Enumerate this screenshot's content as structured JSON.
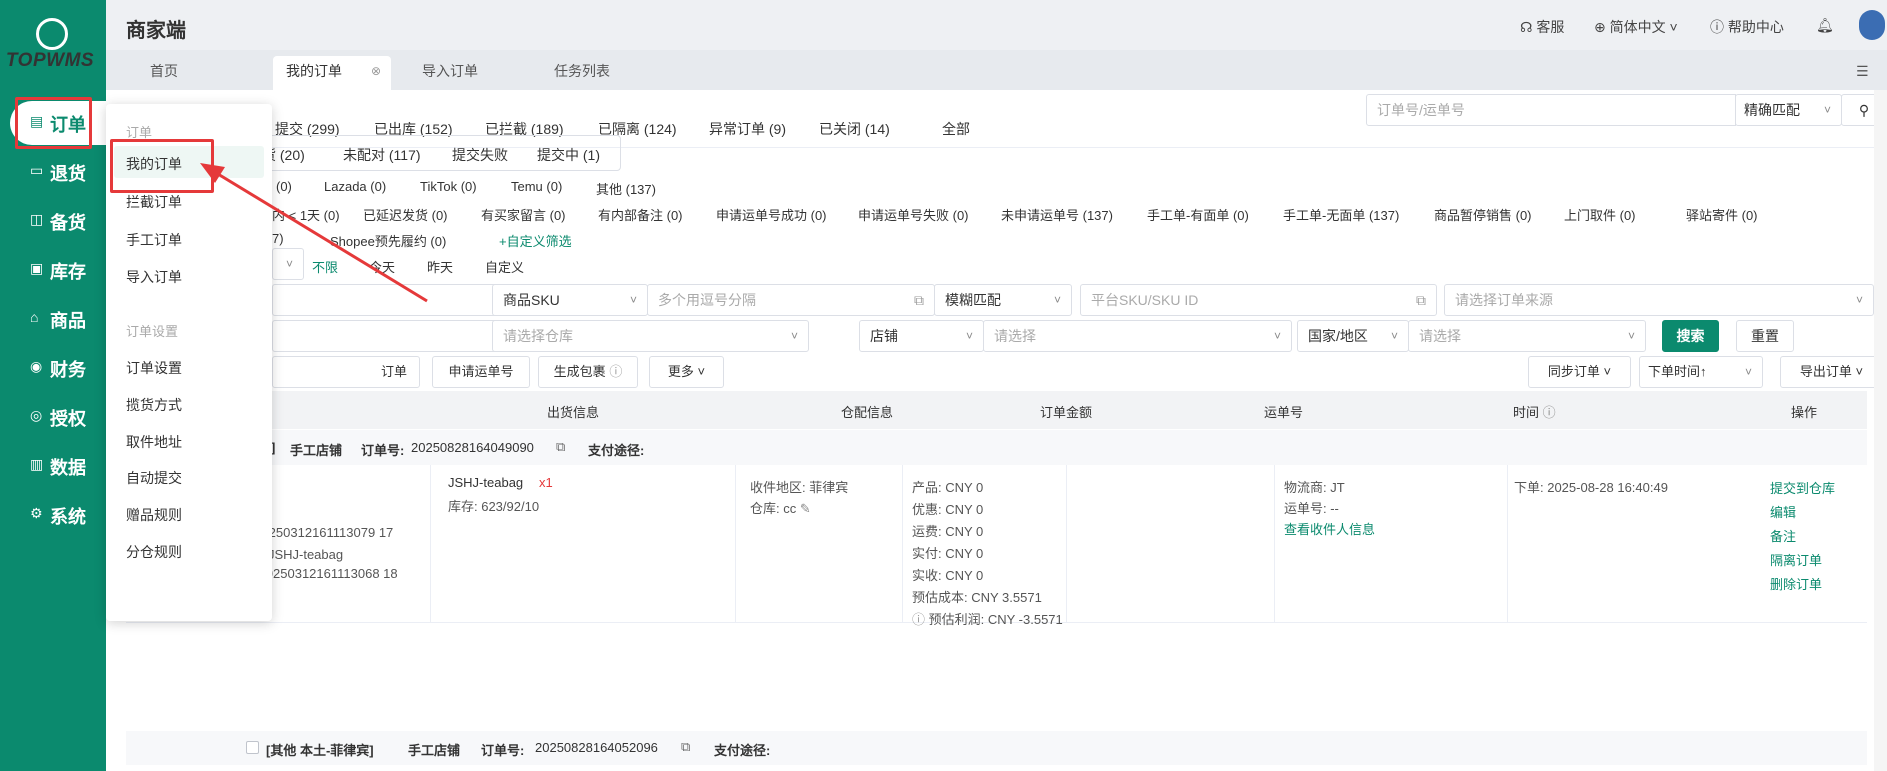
{
  "logo": {
    "text": "TOPWMS"
  },
  "sidebar": {
    "items": [
      {
        "label": "订单",
        "icon": "order-icon"
      },
      {
        "label": "退货",
        "icon": "return-icon"
      },
      {
        "label": "备货",
        "icon": "stock-prep-icon"
      },
      {
        "label": "库存",
        "icon": "inventory-icon"
      },
      {
        "label": "商品",
        "icon": "goods-icon"
      },
      {
        "label": "财务",
        "icon": "finance-icon"
      },
      {
        "label": "授权",
        "icon": "auth-icon"
      },
      {
        "label": "数据",
        "icon": "data-icon"
      },
      {
        "label": "系统",
        "icon": "system-icon"
      }
    ]
  },
  "header": {
    "title": "商家端",
    "service": "客服",
    "language": "简体中文",
    "help": "帮助中心"
  },
  "tabs": [
    {
      "label": "首页"
    },
    {
      "label": "我的订单"
    },
    {
      "label": "导入订单"
    },
    {
      "label": "任务列表"
    }
  ],
  "status_tabs": [
    "提交 (299)",
    "已出库 (152)",
    "已拦截 (189)",
    "已隔离 (124)",
    "异常订单 (9)",
    "已关闭 (14)",
    "全部"
  ],
  "search": {
    "placeholder": "订单号/运单号",
    "match": "精确匹配"
  },
  "sub_tabs": [
    "货 (20)",
    "未配对 (117)",
    "提交失败",
    "提交中 (1)"
  ],
  "platforms": [
    "(0)",
    "Lazada (0)",
    "TikTok (0)",
    "Temu (0)",
    "其他 (137)"
  ],
  "quick_filters": [
    "内 < 1天 (0)",
    "已延迟发货 (0)",
    "有买家留言 (0)",
    "有内部备注 (0)",
    "申请运单号成功 (0)",
    "申请运单号失败 (0)",
    "未申请运单号 (137)",
    "手工单-有面单 (0)",
    "手工单-无面单 (137)",
    "商品暂停销售 (0)",
    "上门取件 (0)",
    "驿站寄件 (0)"
  ],
  "quick_filters2": {
    "a": "7)",
    "b": "Shopee预先履约 (0)",
    "custom": "+自定义筛选"
  },
  "time_filters": [
    "不限",
    "今天",
    "昨天",
    "自定义"
  ],
  "filters": {
    "sku_type": "商品SKU",
    "sku_placeholder": "多个用逗号分隔",
    "match": "模糊匹配",
    "platform_sku": "平台SKU/SKU ID",
    "source": "请选择订单来源",
    "warehouse": "请选择仓库",
    "store": "店铺",
    "store_placeholder": "请选择",
    "country": "国家/地区",
    "country_placeholder": "请选择",
    "search_btn": "搜索",
    "reset_btn": "重置"
  },
  "actions": [
    "订单",
    "申请运单号",
    "生成包裹",
    "更多"
  ],
  "right_actions": [
    "同步订单",
    "下单时间↑",
    "导出订单"
  ],
  "table": {
    "headers": [
      "出货信息",
      "仓配信息",
      "订单金额",
      "运单号",
      "时间",
      "操作"
    ]
  },
  "order1": {
    "header": {
      "tag": "]",
      "store": "手工店铺",
      "order_no_label": "订单号:",
      "order_no": "20250828164049090",
      "pay_label": "支付途径:"
    },
    "product": {
      "l1": "号:",
      "product_id": "产品ID:  20250312161113079 17",
      "platform_sku": "平台SKU:  JSHJ-teabag",
      "sku_id": "SKU ID:  20250312161113068 18"
    },
    "ship": {
      "name": "JSHJ-teabag",
      "qty": "x1",
      "stock": "库存: 623/92/10"
    },
    "wh": {
      "region": "收件地区:  菲律宾",
      "warehouse": "仓库:  cc"
    },
    "amount": [
      "产品:  CNY 0",
      "优惠:  CNY 0",
      "运费:  CNY 0",
      "实付:  CNY 0",
      "实收:  CNY 0",
      "预估成本:  CNY 3.5571",
      "预估利润:  CNY -3.5571"
    ],
    "waybill": {
      "carrier": "物流商:  JT",
      "no": "运单号:  --",
      "view": "查看收件人信息"
    },
    "time": "下单:  2025-08-28 16:40:49",
    "ops": [
      "提交到仓库",
      "编辑",
      "备注",
      "隔离订单",
      "删除订单"
    ]
  },
  "order2": {
    "tag": "[其他 本土-菲律宾]",
    "store": "手工店铺",
    "order_no_label": "订单号:",
    "order_no": "20250828164052096",
    "pay_label": "支付途径:"
  },
  "menu": {
    "group1": "订单",
    "items1": [
      "我的订单",
      "拦截订单",
      "手工订单",
      "导入订单"
    ],
    "group2": "订单设置",
    "items2": [
      "订单设置",
      "揽货方式",
      "取件地址",
      "自动提交",
      "赠品规则",
      "分仓规则"
    ]
  },
  "colors": {
    "brand": "#0b8a6e",
    "highlight": "#e5393a"
  }
}
